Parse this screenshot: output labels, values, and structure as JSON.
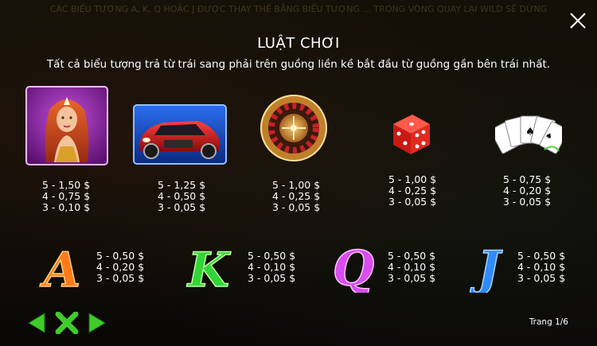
{
  "header": {
    "title": "LUẬT CHƠI",
    "subtitle": "Tất cả biểu tượng trả từ trái sang phải trên guồng liền kề bắt đầu từ guồng gần bên trái nhất."
  },
  "background_ticker": "CÁC BIỂU TƯỢNG A, K, Q HOẶC J ĐƯỢC THAY THẾ BẰNG BIỂU TƯỢNG ... TRONG VÒNG QUAY LẠI WILD SẼ DỪNG",
  "symbols": [
    {
      "name": "woman",
      "payouts": [
        "5 - 1,50 $",
        "4 - 0,75 $",
        "3 - 0,10 $"
      ]
    },
    {
      "name": "car",
      "payouts": [
        "5 - 1,25 $",
        "4 - 0,50 $",
        "3 - 0,05 $"
      ]
    },
    {
      "name": "roulette",
      "payouts": [
        "5 - 1,00 $",
        "4 - 0,25 $",
        "3 - 0,05 $"
      ]
    },
    {
      "name": "dice",
      "payouts": [
        "5 - 1,00 $",
        "4 - 0,25 $",
        "3 - 0,05 $"
      ]
    },
    {
      "name": "cards",
      "payouts": [
        "5 - 0,75 $",
        "4 - 0,20 $",
        "3 - 0,05 $"
      ]
    },
    {
      "name": "A",
      "payouts": [
        "5 - 0,50 $",
        "4 - 0,20 $",
        "3 - 0,05 $"
      ]
    },
    {
      "name": "K",
      "payouts": [
        "5 - 0,50 $",
        "4 - 0,10 $",
        "3 - 0,05 $"
      ]
    },
    {
      "name": "Q",
      "payouts": [
        "5 - 0,50 $",
        "4 - 0,10 $",
        "3 - 0,05 $"
      ]
    },
    {
      "name": "J",
      "payouts": [
        "5 - 0,50 $",
        "4 - 0,10 $",
        "3 - 0,05 $"
      ]
    }
  ],
  "letters": {
    "a": "A",
    "k": "K",
    "q": "Q",
    "j": "J"
  },
  "footer": {
    "page_indicator": "Trang 1/6"
  },
  "colors": {
    "nav_green": "#3fcc2a",
    "letter_a": "#ff7a1a",
    "letter_k": "#33d43a",
    "letter_q": "#d84cf0",
    "letter_j": "#2f8bff"
  }
}
